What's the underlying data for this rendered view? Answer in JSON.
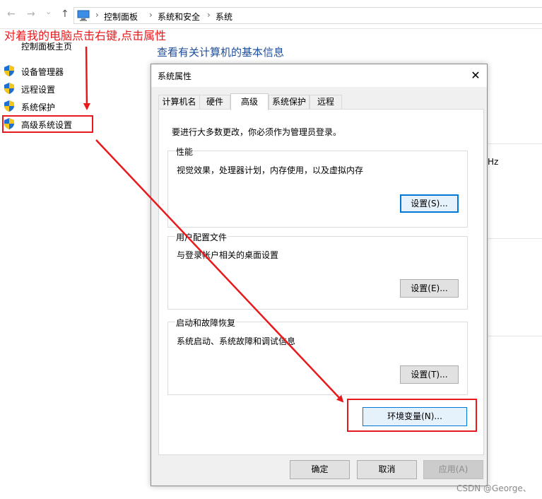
{
  "window": {
    "title_partial": "系统"
  },
  "nav": {
    "back_icon": "←",
    "forward_icon": "→",
    "dropdown_icon": "⌄",
    "up_icon": "↑"
  },
  "breadcrumb": [
    "控制面板",
    "系统和安全",
    "系统"
  ],
  "breadcrumb_sep": "›",
  "left": {
    "home": "控制面板主页",
    "items": [
      {
        "label": "设备管理器",
        "icon": "uac-shield-icon"
      },
      {
        "label": "远程设置",
        "icon": "uac-shield-icon"
      },
      {
        "label": "系统保护",
        "icon": "uac-shield-icon"
      },
      {
        "label": "高级系统设置",
        "icon": "uac-shield-icon"
      }
    ]
  },
  "main": {
    "title": "查看有关计算机的基本信息",
    "partial_text": "Hz"
  },
  "annotation": {
    "text": "对着我的电脑点击右键,点击属性",
    "color": "#e8191c"
  },
  "dialog": {
    "title": "系统属性",
    "close": "✕",
    "tabs": [
      {
        "label": "计算机名",
        "active": false
      },
      {
        "label": "硬件",
        "active": false
      },
      {
        "label": "高级",
        "active": true
      },
      {
        "label": "系统保护",
        "active": false
      },
      {
        "label": "远程",
        "active": false
      }
    ],
    "admin_note": "要进行大多数更改，你必须作为管理员登录。",
    "groups": [
      {
        "title": "性能",
        "desc": "视觉效果，处理器计划，内存使用，以及虚拟内存",
        "button": "设置(S)..."
      },
      {
        "title": "用户配置文件",
        "desc": "与登录帐户相关的桌面设置",
        "button": "设置(E)..."
      },
      {
        "title": "启动和故障恢复",
        "desc": "系统启动、系统故障和调试信息",
        "button": "设置(T)..."
      }
    ],
    "env_button": "环境变量(N)...",
    "ok": "确定",
    "cancel": "取消",
    "apply": "应用(A)"
  },
  "watermark": "CSDN @George、",
  "colors": {
    "link_blue": "#1e4e9c",
    "accent": "#0078d7",
    "annotation_red": "#e8191c"
  }
}
